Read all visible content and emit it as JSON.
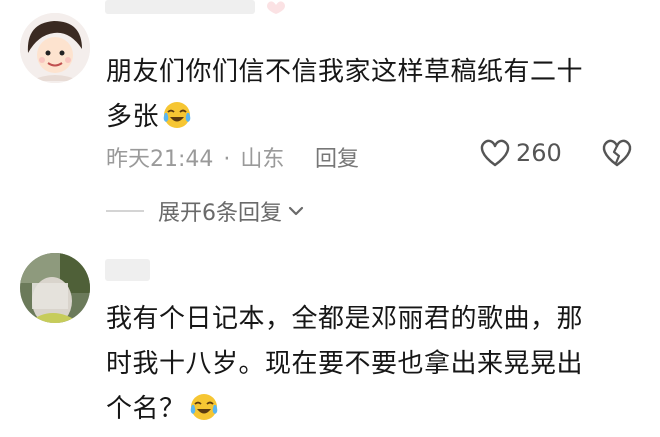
{
  "comments": [
    {
      "text_line1": "朋友们你们信不信我家这样草稿纸有二十",
      "text_line2": "多张",
      "emoji": "tears-of-joy-emoji",
      "time": "昨天21:44",
      "location": "山东",
      "separator": "·",
      "reply_label": "回复",
      "like_count": "260",
      "expand_label": "展开6条回复"
    },
    {
      "text_line1": "我有个日记本，全都是邓丽君的歌曲，那",
      "text_line2": "时我十八岁。现在要不要也拿出来晃晃出",
      "text_line3": "个名？",
      "emoji": "tears-of-joy-emoji"
    }
  ],
  "icons": {
    "like": "heart-outline-icon",
    "dislike": "broken-heart-icon",
    "expand": "chevron-down-icon"
  },
  "colors": {
    "text": "#161616",
    "meta": "#9a9a9a",
    "accent_emoji": "#f6c633"
  }
}
